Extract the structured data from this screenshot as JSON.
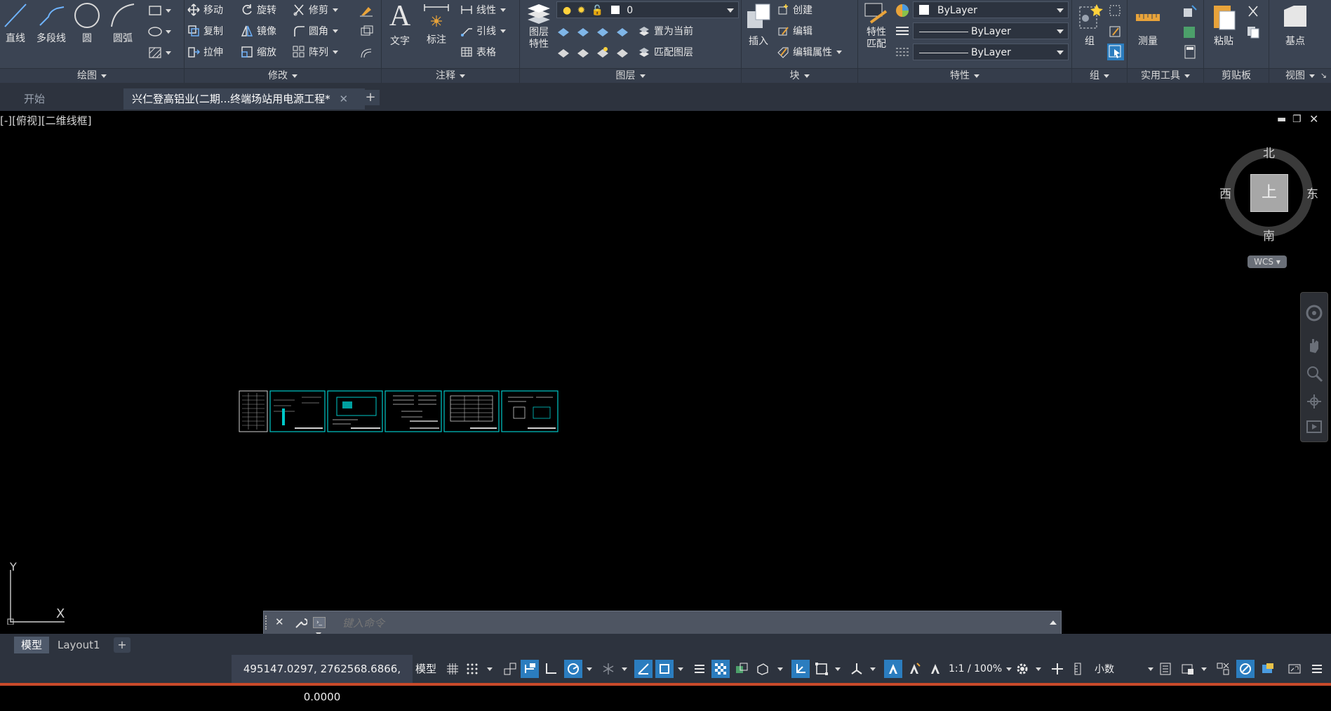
{
  "ribbon": {
    "draw": {
      "title": "绘图",
      "tools": [
        "直线",
        "多段线",
        "圆",
        "圆弧"
      ]
    },
    "modify": {
      "title": "修改",
      "rows": [
        [
          "移动",
          "旋转",
          "修剪"
        ],
        [
          "复制",
          "镜像",
          "圆角"
        ],
        [
          "拉伸",
          "缩放",
          "阵列"
        ]
      ]
    },
    "annotation": {
      "title": "注释",
      "big": [
        "文字",
        "标注"
      ],
      "rows": [
        "线性",
        "引线",
        "表格"
      ]
    },
    "layers": {
      "title": "图层",
      "big_line1": "图层",
      "big_line2": "特性",
      "layer_value": "0",
      "actions": [
        "置为当前",
        "匹配图层"
      ]
    },
    "block": {
      "title": "块",
      "big": "插入",
      "rows": [
        "创建",
        "编辑",
        "编辑属性"
      ]
    },
    "properties": {
      "title": "特性",
      "big_line1": "特性",
      "big_line2": "匹配",
      "color": "ByLayer",
      "linetype": "ByLayer",
      "lineweight": "ByLayer"
    },
    "groups": {
      "title": "组",
      "big": "组"
    },
    "utilities": {
      "title": "实用工具",
      "big": "测量"
    },
    "clipboard": {
      "title": "剪贴板",
      "big": "粘贴"
    },
    "view": {
      "title": "视图",
      "big": "基点"
    }
  },
  "tabs": [
    {
      "label": "开始"
    },
    {
      "label": "兴仁登高铝业(二期...终端场站用电源工程*"
    }
  ],
  "viewport": {
    "label": "[-][俯视][二维线框]",
    "viewcube": {
      "north": "北",
      "south": "南",
      "east": "东",
      "west": "西",
      "top": "上",
      "wcs": "WCS"
    },
    "ucs": {
      "x": "X",
      "y": "Y"
    }
  },
  "command": {
    "placeholder": "键入命令"
  },
  "layout_tabs": [
    {
      "label": "模型"
    },
    {
      "label": "Layout1"
    }
  ],
  "status": {
    "coords": "495147.0297, 2762568.6866, 0.0000",
    "model": "模型",
    "scale": "1:1 / 100%",
    "units": "小数"
  },
  "colors": {
    "ribbon": "#3b4453",
    "accent": "#2b7dbf",
    "drawing_frame": "#00c8c8"
  }
}
